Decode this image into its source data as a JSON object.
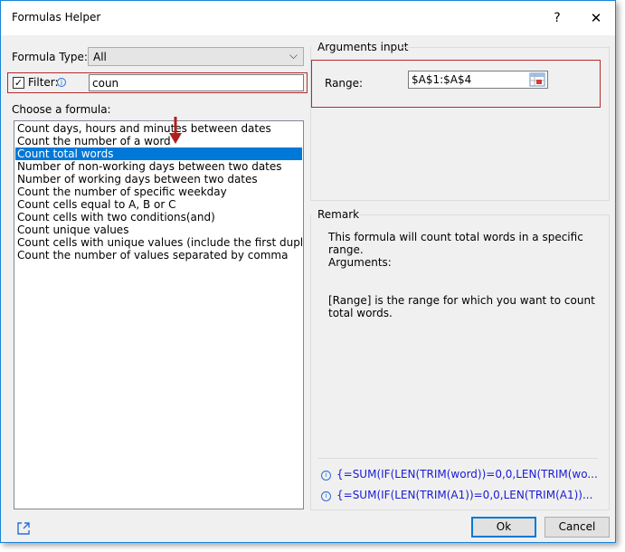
{
  "window": {
    "title": "Formulas Helper",
    "help_glyph": "?",
    "close_glyph": "✕"
  },
  "formula_type": {
    "label": "Formula Type:",
    "value": "All"
  },
  "filter": {
    "label": "Filter:",
    "checked": true,
    "value": "coun"
  },
  "choose_label": "Choose a formula:",
  "formulas": [
    "Count days, hours and minutes between dates",
    "Count the number of a word",
    "Count total words",
    "Number of non-working days between two dates",
    "Number of working days between two dates",
    "Count the number of specific weekday",
    "Count cells equal to A, B or C",
    "Count cells with two conditions(and)",
    "Count unique values",
    "Count cells with unique values (include the first duplicate",
    "Count the number of values separated by comma"
  ],
  "selected_formula": "Count total words",
  "arguments": {
    "group_label": "Arguments input",
    "range_label": "Range:",
    "range_value": "$A$1:$A$4"
  },
  "remark": {
    "group_label": "Remark",
    "line1": "This formula will count total words in a specific range.",
    "line2": "Arguments:",
    "line3": "[Range] is the range for which you want to count total words.",
    "formula1": "{=SUM(IF(LEN(TRIM(word))=0,0,LEN(TRIM(wo...",
    "formula2": "{=SUM(IF(LEN(TRIM(A1))=0,0,LEN(TRIM(A1))..."
  },
  "buttons": {
    "ok": "Ok",
    "cancel": "Cancel"
  },
  "colors": {
    "accent": "#0078d7",
    "highlight_border": "#b32c2c",
    "formula_text": "#1a1ad6"
  }
}
